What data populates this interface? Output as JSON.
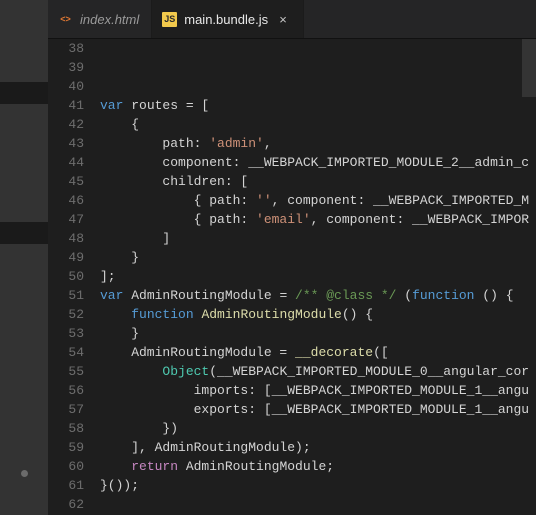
{
  "tabs": [
    {
      "icon": "<>",
      "label": "index.html",
      "active": false,
      "closable": false
    },
    {
      "icon": "JS",
      "label": "main.bundle.js",
      "active": true,
      "closable": true,
      "close": "×"
    }
  ],
  "gutter_start": 38,
  "lines": [
    {
      "segs": []
    },
    {
      "segs": []
    },
    {
      "segs": []
    },
    {
      "segs": [
        {
          "t": "var ",
          "c": "kw"
        },
        {
          "t": "routes = [",
          "c": "pl"
        }
      ]
    },
    {
      "segs": [
        {
          "t": "    {",
          "c": "pl"
        }
      ]
    },
    {
      "segs": [
        {
          "t": "        path: ",
          "c": "pl"
        },
        {
          "t": "'admin'",
          "c": "str"
        },
        {
          "t": ",",
          "c": "pl"
        }
      ]
    },
    {
      "segs": [
        {
          "t": "        component: __WEBPACK_IMPORTED_MODULE_2__admin_c",
          "c": "pl"
        }
      ]
    },
    {
      "segs": [
        {
          "t": "        children: [",
          "c": "pl"
        }
      ]
    },
    {
      "segs": [
        {
          "t": "            { path: ",
          "c": "pl"
        },
        {
          "t": "''",
          "c": "str"
        },
        {
          "t": ", component: __WEBPACK_IMPORTED_M",
          "c": "pl"
        }
      ]
    },
    {
      "segs": [
        {
          "t": "            { path: ",
          "c": "pl"
        },
        {
          "t": "'email'",
          "c": "str"
        },
        {
          "t": ", component: __WEBPACK_IMPOR",
          "c": "pl"
        }
      ]
    },
    {
      "segs": [
        {
          "t": "        ]",
          "c": "pl"
        }
      ]
    },
    {
      "segs": [
        {
          "t": "    }",
          "c": "pl"
        }
      ]
    },
    {
      "segs": [
        {
          "t": "];",
          "c": "pl"
        }
      ]
    },
    {
      "segs": [
        {
          "t": "var ",
          "c": "kw"
        },
        {
          "t": "AdminRoutingModule = ",
          "c": "pl"
        },
        {
          "t": "/** @class */",
          "c": "cm"
        },
        {
          "t": " (",
          "c": "pl"
        },
        {
          "t": "function",
          "c": "kw"
        },
        {
          "t": " () {",
          "c": "pl"
        }
      ]
    },
    {
      "segs": [
        {
          "t": "    ",
          "c": "pl"
        },
        {
          "t": "function ",
          "c": "kw"
        },
        {
          "t": "AdminRoutingModule",
          "c": "fn"
        },
        {
          "t": "() {",
          "c": "pl"
        }
      ]
    },
    {
      "segs": [
        {
          "t": "    }",
          "c": "pl"
        }
      ]
    },
    {
      "segs": [
        {
          "t": "    AdminRoutingModule = ",
          "c": "pl"
        },
        {
          "t": "__decorate",
          "c": "fn"
        },
        {
          "t": "([",
          "c": "pl"
        }
      ]
    },
    {
      "segs": [
        {
          "t": "        ",
          "c": "pl"
        },
        {
          "t": "Object",
          "c": "cls"
        },
        {
          "t": "(__WEBPACK_IMPORTED_MODULE_0__angular_cor",
          "c": "pl"
        }
      ]
    },
    {
      "segs": [
        {
          "t": "            imports: [__WEBPACK_IMPORTED_MODULE_1__angu",
          "c": "pl"
        }
      ]
    },
    {
      "segs": [
        {
          "t": "            exports: [__WEBPACK_IMPORTED_MODULE_1__angu",
          "c": "pl"
        }
      ]
    },
    {
      "segs": [
        {
          "t": "        })",
          "c": "pl"
        }
      ]
    },
    {
      "segs": [
        {
          "t": "    ], AdminRoutingModule);",
          "c": "pl"
        }
      ]
    },
    {
      "segs": [
        {
          "t": "    ",
          "c": "pl"
        },
        {
          "t": "return",
          "c": "ret"
        },
        {
          "t": " AdminRoutingModule;",
          "c": "pl"
        }
      ]
    },
    {
      "segs": [
        {
          "t": "}());",
          "c": "pl"
        }
      ]
    },
    {
      "segs": []
    }
  ]
}
